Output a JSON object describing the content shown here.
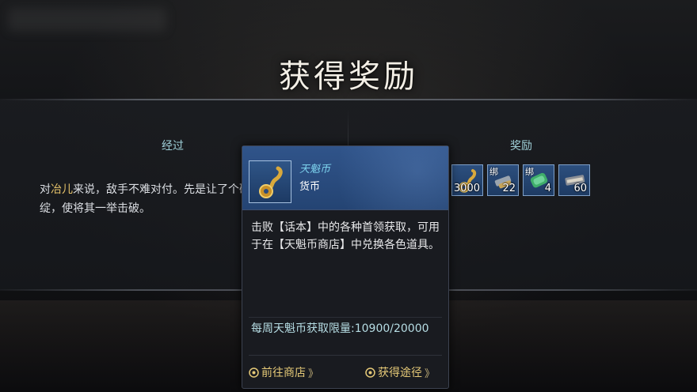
{
  "header": {
    "title": "获得奖励"
  },
  "left": {
    "label": "经过",
    "story_prefix": "对",
    "story_name": "冶儿",
    "story_rest": "来说，敌手不难对付。先是让了个破绽，使将其一举击破。"
  },
  "right": {
    "label": "奖励",
    "rewards": [
      {
        "icon": "currency-coin-icon",
        "qty": "3000",
        "bound": ""
      },
      {
        "icon": "material-tool-icon",
        "qty": "22",
        "bound": "绑"
      },
      {
        "icon": "jade-green-icon",
        "qty": "4",
        "bound": "绑"
      },
      {
        "icon": "bundle-icon",
        "qty": "60",
        "bound": ""
      }
    ]
  },
  "tooltip": {
    "name": "天魁币",
    "type": "货币",
    "description": "击败【话本】中的各种首领获取，可用于在【天魁币商店】中兑换各色道具。",
    "limit_text": "每周天魁币获取限量:10900/20000",
    "btn_shop": "前往商店",
    "btn_source": "获得途径",
    "btn_arrow": "》",
    "colors": {
      "accent": "#e5c977",
      "header_bg": "#2a4b7e"
    }
  }
}
